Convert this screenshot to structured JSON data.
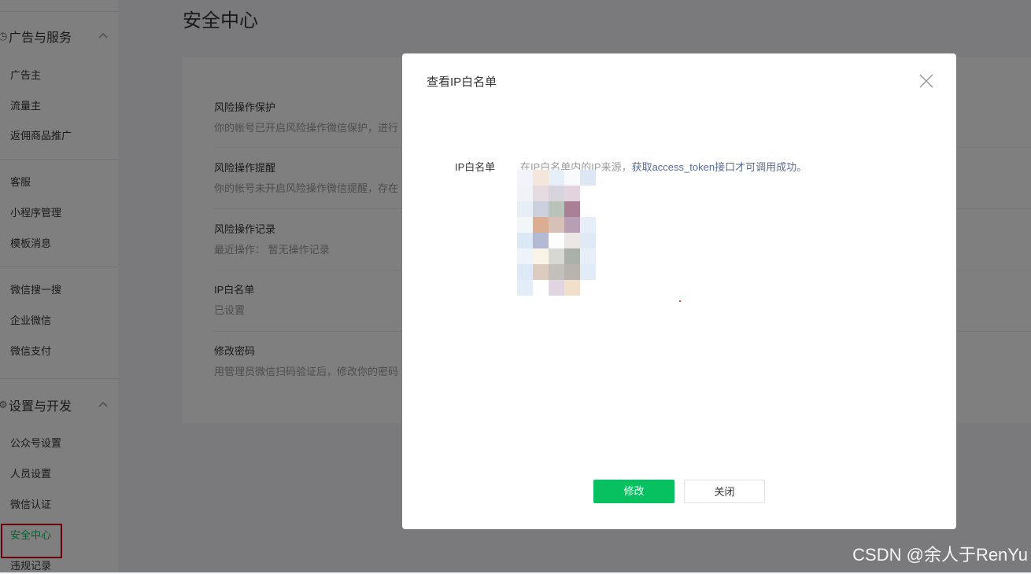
{
  "sidebar": {
    "section1_title": "广告与服务",
    "section1_items": [
      "广告主",
      "流量主",
      "返佣商品推广"
    ],
    "group2_items": [
      "客服",
      "小程序管理",
      "模板消息"
    ],
    "group3_items": [
      "微信搜一搜",
      "企业微信",
      "微信支付"
    ],
    "section2_title": "设置与开发",
    "section2_items": [
      "公众号设置",
      "人员设置",
      "微信认证",
      "安全中心",
      "违规记录"
    ]
  },
  "main": {
    "page_title": "安全中心",
    "rows": [
      {
        "title": "风险操作保护",
        "desc": "你的帐号已开启风险操作微信保护，进行"
      },
      {
        "title": "风险操作提醒",
        "desc": "你的帐号未开启风险操作微信提醒，存在"
      },
      {
        "title": "风险操作记录",
        "desc": "最近操作：   暂无操作记录"
      },
      {
        "title": "IP白名单",
        "desc": "已设置"
      },
      {
        "title": "修改密码",
        "desc": "用管理员微信扫码验证后，修改你的密码"
      }
    ]
  },
  "dialog": {
    "title": "查看IP白名单",
    "field_label": "IP白名单",
    "desc_prefix": "在IP白名单内的IP来源，",
    "desc_link": "获取access_token接口才可调用成功。",
    "confirm_label": "修改",
    "close_label": "关闭"
  },
  "watermark": "CSDN @余人于RenYu",
  "colors": {
    "brand_green": "#07c160",
    "link_blue": "#576b95",
    "highlight_red": "#d0021b"
  }
}
